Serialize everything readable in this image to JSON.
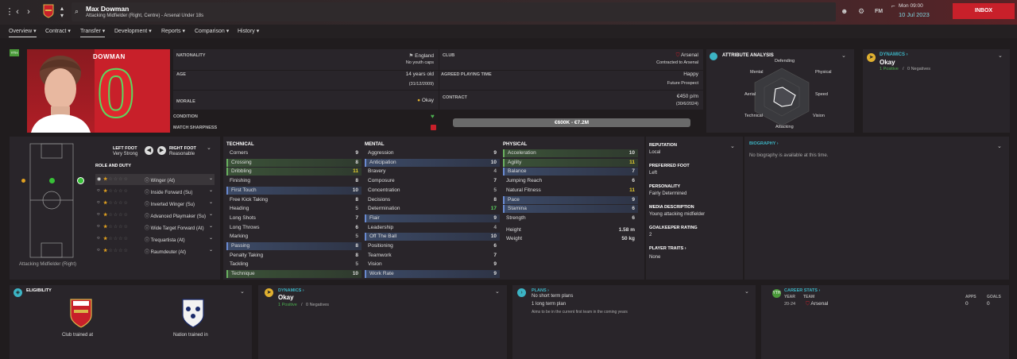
{
  "header": {
    "name": "Max Dowman",
    "subtitle": "Attacking Midfielder (Right, Centre) - Arsenal Under 18s",
    "fm": "FM",
    "day": "Mon 09:00",
    "date": "10 Jul 2023",
    "inbox": "INBOX"
  },
  "menu": [
    "Overview",
    "Contract",
    "Transfer",
    "Development",
    "Reports",
    "Comparison",
    "History"
  ],
  "player": {
    "shirt_name": "DOWMAN",
    "number": "0",
    "badge": "YTH"
  },
  "info": {
    "nationality_label": "NATIONALITY",
    "nationality": "England",
    "youth_caps": "No youth caps",
    "age_label": "AGE",
    "age": "14 years old",
    "dob": "(31/12/2009)",
    "morale_label": "MORALE",
    "morale": "Okay",
    "condition_label": "CONDITION",
    "sharpness_label": "MATCH SHARPNESS",
    "club_label": "CLUB",
    "club": "Arsenal",
    "contracted": "Contracted to Arsenal",
    "apt_label": "AGREED PLAYING TIME",
    "apt": "Happy",
    "apt_sub": "Future Prospect",
    "contract_label": "CONTRACT",
    "wage": "€450 p/m",
    "expiry": "(30/6/2024)",
    "value": "€600K - €7.2M"
  },
  "attr_analysis": {
    "title": "ATTRIBUTE ANALYSIS",
    "labels": [
      "Defending",
      "Physical",
      "Speed",
      "Vision",
      "Attacking",
      "Technical",
      "Aerial",
      "Mental"
    ]
  },
  "dynamics_top": {
    "title": "DYNAMICS",
    "status": "Okay",
    "positives": "1 Positive",
    "sep": "/",
    "negatives": "0 Negatives"
  },
  "feet": {
    "left_label": "LEFT FOOT",
    "left": "Very Strong",
    "right_label": "RIGHT FOOT",
    "right": "Reasonable"
  },
  "roles": {
    "title": "ROLE AND DUTY",
    "items": [
      "Winger (At)",
      "Inside Forward (Su)",
      "Inverted Winger (Su)",
      "Advanced Playmaker (Su)",
      "Wide Target Forward (At)",
      "Trequartista (At)",
      "Raumdeuter (At)"
    ],
    "position": "Attacking Midfielder (Right)"
  },
  "technical": {
    "title": "TECHNICAL",
    "items": [
      [
        "Corners",
        "9"
      ],
      [
        "Crossing",
        "8"
      ],
      [
        "Dribbling",
        "11"
      ],
      [
        "Finishing",
        "8"
      ],
      [
        "First Touch",
        "10"
      ],
      [
        "Free Kick Taking",
        "8"
      ],
      [
        "Heading",
        "5"
      ],
      [
        "Long Shots",
        "7"
      ],
      [
        "Long Throws",
        "6"
      ],
      [
        "Marking",
        "5"
      ],
      [
        "Passing",
        "8"
      ],
      [
        "Penalty Taking",
        "8"
      ],
      [
        "Tackling",
        "5"
      ],
      [
        "Technique",
        "10"
      ]
    ]
  },
  "mental": {
    "title": "MENTAL",
    "items": [
      [
        "Aggression",
        "9"
      ],
      [
        "Anticipation",
        "10"
      ],
      [
        "Bravery",
        "4"
      ],
      [
        "Composure",
        "7"
      ],
      [
        "Concentration",
        "5"
      ],
      [
        "Decisions",
        "8"
      ],
      [
        "Determination",
        "17"
      ],
      [
        "Flair",
        "9"
      ],
      [
        "Leadership",
        "4"
      ],
      [
        "Off The Ball",
        "10"
      ],
      [
        "Positioning",
        "6"
      ],
      [
        "Teamwork",
        "7"
      ],
      [
        "Vision",
        "9"
      ],
      [
        "Work Rate",
        "9"
      ]
    ]
  },
  "physical": {
    "title": "PHYSICAL",
    "items": [
      [
        "Acceleration",
        "10"
      ],
      [
        "Agility",
        "11"
      ],
      [
        "Balance",
        "7"
      ],
      [
        "Jumping Reach",
        "6"
      ],
      [
        "Natural Fitness",
        "11"
      ],
      [
        "Pace",
        "9"
      ],
      [
        "Stamina",
        "6"
      ],
      [
        "Strength",
        "6"
      ]
    ],
    "height_label": "Height",
    "height": "1.58 m",
    "weight_label": "Weight",
    "weight": "50 kg"
  },
  "side": {
    "reputation_label": "REPUTATION",
    "reputation": "Local",
    "foot_label": "PREFERRED FOOT",
    "foot": "Left",
    "personality_label": "PERSONALITY",
    "personality": "Fairly Determined",
    "media_label": "MEDIA DESCRIPTION",
    "media": "Young attacking midfielder",
    "gk_label": "GOALKEEPER RATING",
    "gk": "2",
    "traits_label": "PLAYER TRAITS",
    "traits": "None"
  },
  "biography": {
    "title": "BIOGRAPHY",
    "text": "No biography is available at this time."
  },
  "eligibility": {
    "title": "ELIGIBILITY",
    "club_caption": "Club trained at",
    "nation_caption": "Nation trained in"
  },
  "dynamics_bottom": {
    "title": "DYNAMICS",
    "status": "Okay",
    "positives": "1 Positive",
    "sep": "/",
    "negatives": "0 Negatives"
  },
  "plans": {
    "title": "PLANS",
    "line1": "No short term plans",
    "line2": "1 long term plan",
    "line3": "Aims to be in the current first team in the coming years"
  },
  "career": {
    "title": "CAREER STATS",
    "year_h": "YEAR",
    "team_h": "TEAM",
    "apps_h": "APPS",
    "goals_h": "GOALS",
    "year": "20-24",
    "team": "Arsenal",
    "apps": "0",
    "goals": "0"
  },
  "colors": {
    "accent": "#c8202a",
    "teal": "#3cb4c4",
    "positive": "#4caf50",
    "yellow": "#e0b030"
  }
}
